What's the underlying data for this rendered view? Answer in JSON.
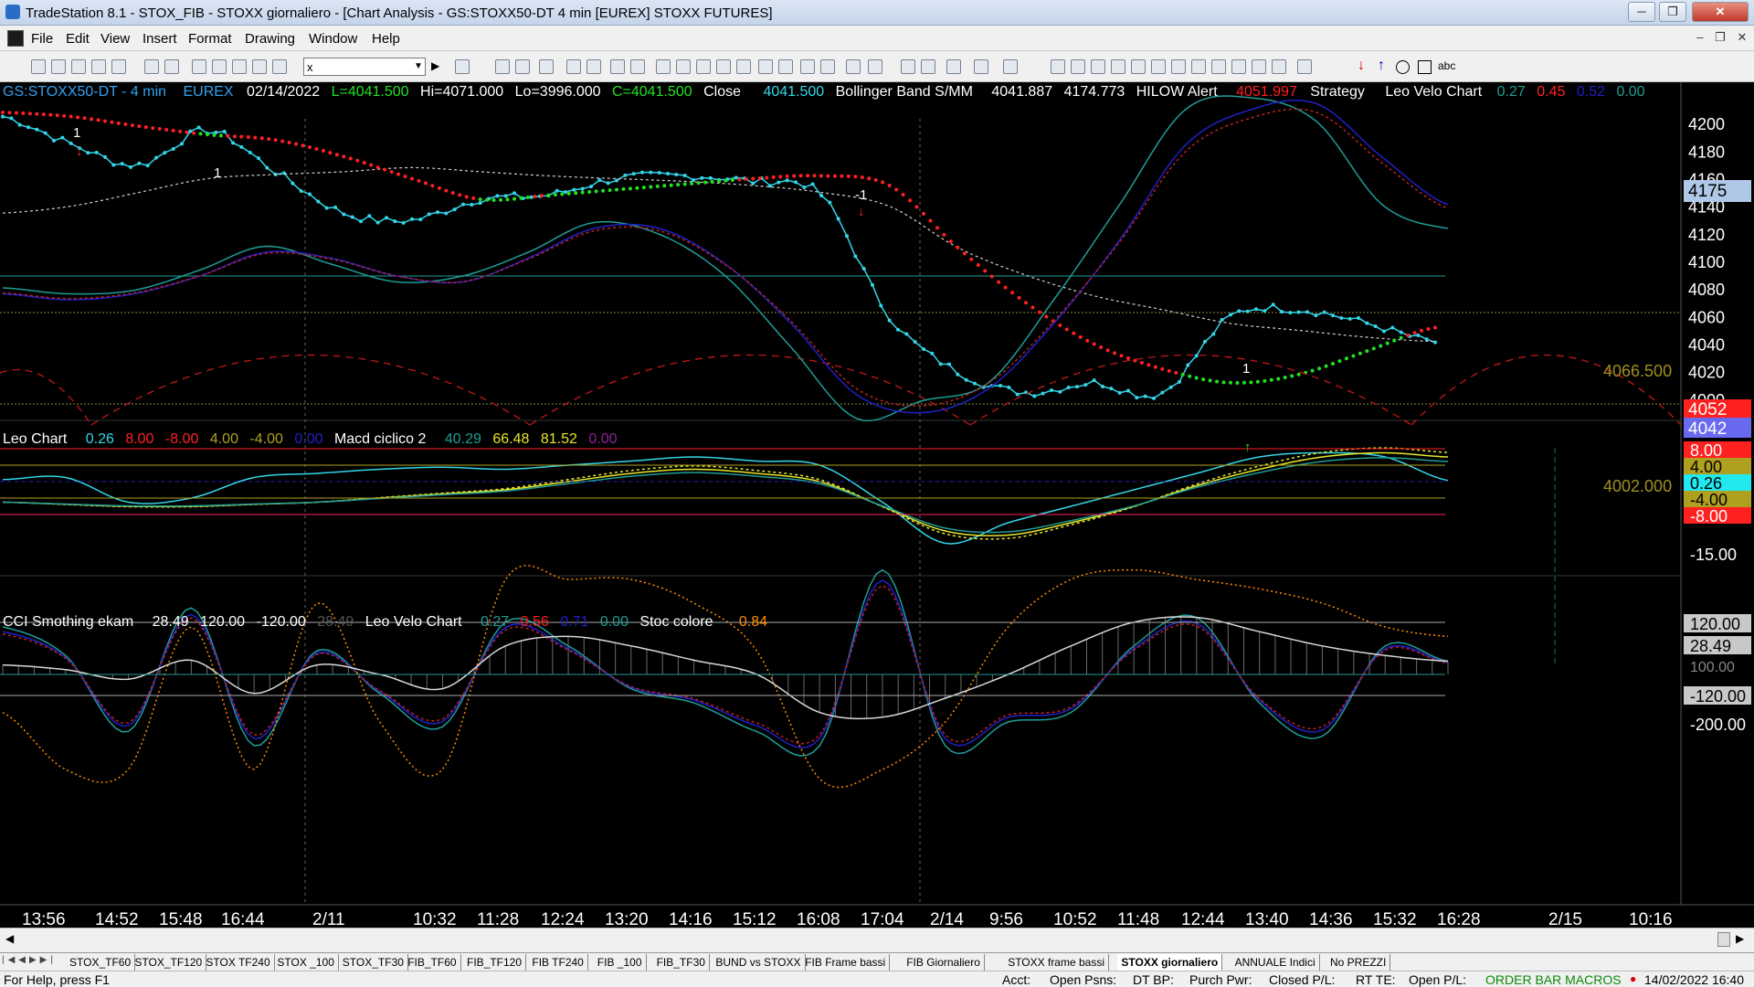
{
  "window": {
    "title": "TradeStation 8.1 - STOX_FIB - STOXX giornaliero - [Chart Analysis - GS:STOXX50-DT  4 min  [EUREX] STOXX FUTURES]",
    "minimize": "─",
    "maximize": "❐",
    "close": "✕"
  },
  "menu": {
    "items": [
      "File",
      "Edit",
      "View",
      "Insert",
      "Format",
      "Drawing",
      "Window",
      "Help"
    ],
    "mdi_minimize": "–",
    "mdi_restore": "❐",
    "mdi_close": "✕"
  },
  "toolbar": {
    "symbol_value": "x",
    "icons": [
      "new-icon",
      "open-icon",
      "save-icon",
      "print-icon",
      "chart-icon",
      "zoom-in-icon",
      "zoom-out-icon",
      "cursor-icon",
      "arrow-up-icon",
      "arrow-down-icon",
      "circle-icon",
      "rect-icon",
      "text-icon"
    ],
    "text_tool": "abc"
  },
  "colors": {
    "bg": "#000000",
    "price": "#33d6e8",
    "bb_mid": "#d0d0d0",
    "sar_red": "#ff2020",
    "sar_green": "#22e022",
    "leo_fast": "#1e9d96",
    "leo_slow": "#2020c8",
    "leo_dot": "#c02020",
    "cycle": "#c01818",
    "macd": "#e6e62a",
    "olive": "#b0a020",
    "axis_text": "#ffffff"
  },
  "panel1": {
    "header": {
      "symbol": "GS:STOXX50-DT - 4 min",
      "exchange": "EUREX",
      "date": "02/14/2022",
      "low_label": "L=4041.500",
      "hi_label": "Hi=4071.000",
      "lo_label": "Lo=3996.000",
      "close_label": "C=4041.500",
      "close_word": "Close",
      "close_value": "4041.500",
      "bb_name": "Bollinger Band S/MM",
      "bb_v1": "4041.887",
      "bb_v2": "4174.773",
      "hilow_name": "HILOW Alert",
      "hilow_value": "4051.997",
      "strategy_name": "Strategy",
      "leo_name": "Leo Velo Chart",
      "leo_v1": "0.27",
      "leo_v2": "0.45",
      "leo_v3": "0.52",
      "leo_v4": "0.00"
    },
    "y_ticks": [
      "4200",
      "4180",
      "4160",
      "4140",
      "4120",
      "4100",
      "4080",
      "4060",
      "4040",
      "4020",
      "4000"
    ],
    "y_range": [
      3990,
      4210
    ],
    "level_upper": "4066.500",
    "level_lower": "4002.000",
    "badge_top": "4175",
    "badge_red": "4052",
    "badge_blue": "4042",
    "marker_down": "-1",
    "marker_one_a": "1",
    "marker_one_b": "1",
    "marker_one_c": "1",
    "marker_minus": "-1"
  },
  "panel2": {
    "header": {
      "name": "Leo Chart",
      "v1": "0.26",
      "v2": "8.00",
      "v3": "-8.00",
      "v4": "4.00",
      "v5": "-4.00",
      "v6": "0.00",
      "macd_name": "Macd ciclico 2",
      "m1": "40.29",
      "m2": "66.48",
      "m3": "81.52",
      "m4": "0.00"
    },
    "axis_labels": [
      "8.00",
      "4.00",
      "0.26",
      "-4.00",
      "-8.00",
      "-15.00"
    ]
  },
  "panel3": {
    "header": {
      "cci_name": "CCI Smothing ekam",
      "c1": "28.49",
      "c2": "120.00",
      "c3": "-120.00",
      "c4": "28.49",
      "leo_name": "Leo Velo Chart",
      "l1": "0.27",
      "l2": "0.56",
      "l3": "0.71",
      "l4": "0.00",
      "stoc_name": "Stoc colore",
      "s1": "0.84"
    },
    "axis_labels": [
      "120.00",
      "28.49",
      "-120.00",
      "-200.00"
    ],
    "axis_partial": "100.00"
  },
  "time_axis": [
    "13:56",
    "14:52",
    "15:48",
    "16:44",
    "2/11",
    "10:32",
    "11:28",
    "12:24",
    "13:20",
    "14:16",
    "15:12",
    "16:08",
    "17:04",
    "2/14",
    "9:56",
    "10:52",
    "11:48",
    "12:44",
    "13:40",
    "14:36",
    "15:32",
    "16:28",
    "2/15",
    "10:16"
  ],
  "chart_data": {
    "type": "line",
    "title": "",
    "x": [
      "13:56",
      "14:52",
      "15:48",
      "16:44",
      "2/11",
      "10:32",
      "11:28",
      "12:24",
      "13:20",
      "14:16",
      "15:12",
      "16:08",
      "17:04",
      "2/14",
      "9:56",
      "10:52",
      "11:48",
      "12:44",
      "13:40",
      "14:36",
      "15:32",
      "16:28"
    ],
    "series": [
      {
        "name": "Close",
        "values": [
          4205,
          4185,
          4170,
          4195,
          4165,
          4135,
          4130,
          4145,
          4148,
          4160,
          4162,
          4158,
          4148,
          4060,
          4020,
          4005,
          4012,
          4005,
          4060,
          4065,
          4055,
          4041.5
        ]
      },
      {
        "name": "Bollinger Band S/MM",
        "values": [
          4135,
          4140,
          4150,
          4160,
          4163,
          4165,
          4168,
          4165,
          4162,
          4160,
          4158,
          4155,
          4150,
          4140,
          4110,
          4090,
          4075,
          4065,
          4055,
          4050,
          4045,
          4041.887
        ]
      },
      {
        "name": "HILOW Alert",
        "values": [
          4208,
          4205,
          4198,
          4192,
          4188,
          4176,
          4160,
          4145,
          4148,
          4152,
          4156,
          4160,
          4162,
          4155,
          4110,
          4070,
          4040,
          4022,
          4012,
          4018,
          4035,
          4051.997
        ]
      }
    ],
    "ylabel": "",
    "ylim": [
      3990,
      4210
    ],
    "levels": [
      4066.5,
      4002.0
    ],
    "grid": false,
    "legend": "top-left"
  },
  "tabs": [
    "STOX_TF60",
    "STOX_TF120",
    "STOX TF240",
    "STOX _100",
    "STOX_TF30",
    "FIB_TF60",
    "FIB_TF120",
    "FIB TF240",
    "FIB _100",
    "FIB_TF30",
    "BUND vs STOXX",
    "FIB Frame bassi",
    "FIB Giornaliero",
    "STOXX frame bassi",
    "STOXX giornaliero",
    "ANNUALE Indici",
    "No PREZZI"
  ],
  "active_tab": "STOXX giornaliero",
  "status": {
    "help": "For Help, press F1",
    "acct": "Acct:",
    "open_psns": "Open Psns:",
    "dt_bp": "DT BP:",
    "purch_pwr": "Purch Pwr:",
    "closed_pl": "Closed P/L:",
    "rt_te": "RT TE:",
    "open_pl": "Open P/L:",
    "macros": "ORDER BAR  MACROS",
    "datetime": "14/02/2022 16:40"
  }
}
